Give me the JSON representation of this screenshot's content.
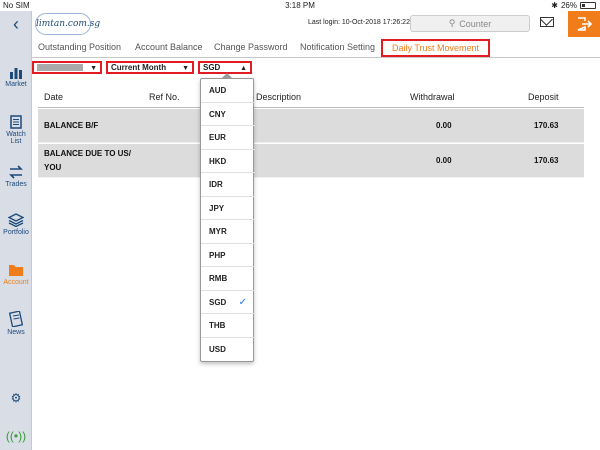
{
  "status_bar": {
    "carrier": "No SIM",
    "time": "3:18 PM",
    "battery": "26%"
  },
  "sidebar": {
    "back": "‹",
    "items": [
      {
        "label": "Market"
      },
      {
        "label": "Watch",
        "label2": "List"
      },
      {
        "label": "Trades"
      },
      {
        "label": "Portfolio"
      },
      {
        "label": "Account"
      },
      {
        "label": "News"
      }
    ]
  },
  "header": {
    "logo_text": "limtan.com.sg",
    "last_login": "Last login: 10-Oct-2018 17:26:22",
    "counter_placeholder": "Counter"
  },
  "tabs": [
    "Outstanding Position",
    "Account Balance",
    "Change Password",
    "Notification Setting",
    "Daily Trust Movement"
  ],
  "filters": {
    "period": "Current Month",
    "currency": "SGD"
  },
  "table": {
    "headers": {
      "date": "Date",
      "ref": "Ref No.",
      "description": "Description",
      "withdrawal": "Withdrawal",
      "deposit": "Deposit"
    },
    "rows": [
      {
        "label": "BALANCE B/F",
        "withdrawal": "0.00",
        "deposit": "170.63"
      },
      {
        "label": "BALANCE DUE TO US/",
        "label2": "YOU",
        "withdrawal": "0.00",
        "deposit": "170.63"
      }
    ]
  },
  "currency_dropdown": {
    "options": [
      "AUD",
      "CNY",
      "EUR",
      "HKD",
      "IDR",
      "JPY",
      "MYR",
      "PHP",
      "RMB",
      "SGD",
      "THB",
      "USD"
    ],
    "selected": "SGD",
    "check": "✓"
  },
  "colors": {
    "accent": "#f07d1a",
    "highlight_border": "#e31b23",
    "sidebar_bg": "#d8dde6",
    "row_bg": "#dcdcdc",
    "nav_blue": "#1e4a7a"
  }
}
